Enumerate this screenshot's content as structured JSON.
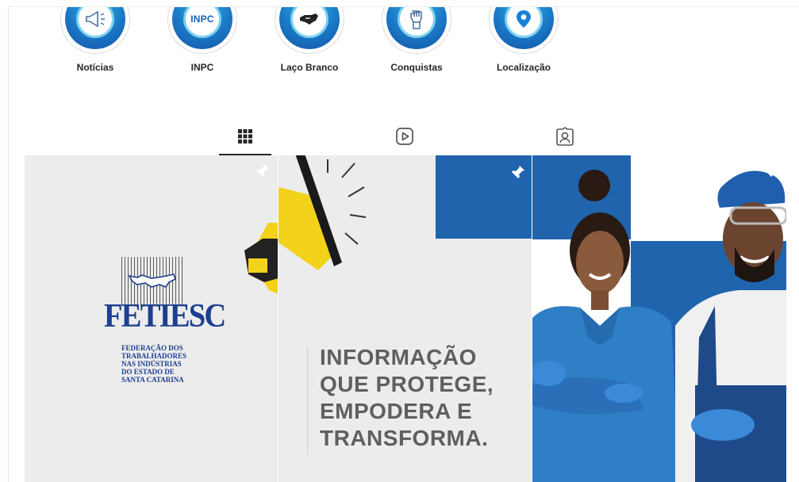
{
  "highlights": [
    {
      "label": "Notícias",
      "icon": "megaphone-icon"
    },
    {
      "label": "INPC",
      "icon": "inpc-badge",
      "badge_text": "INPC"
    },
    {
      "label": "Laço Branco",
      "icon": "hand-icon"
    },
    {
      "label": "Conquistas",
      "icon": "raised-fist-icon"
    },
    {
      "label": "Localização",
      "icon": "location-pin-icon"
    }
  ],
  "tabs": [
    {
      "name": "posts",
      "icon": "grid-icon",
      "active": true
    },
    {
      "name": "reels",
      "icon": "reels-icon",
      "active": false
    },
    {
      "name": "tagged",
      "icon": "tagged-icon",
      "active": false
    }
  ],
  "posts": [
    {
      "pinned": true,
      "logo_title": "FETIESC",
      "logo_subtitle": "FEDERAÇÃO DOS\nTRABALHADORES\nNAS INDÚSTRIAS\nDO ESTADO DE\nSANTA CATARINA"
    },
    {
      "pinned": true,
      "headline": "INFORMAÇÃO\nQUE PROTEGE,\nEMPODERA E\nTRANSFORMA."
    },
    {
      "pinned": true,
      "image": "workers-photo"
    }
  ],
  "colors": {
    "brand_blue": "#1f64ad",
    "highlight_gradient_start": "#2fb6df",
    "highlight_gradient_end": "#1553a6",
    "megaphone_yellow": "#f2d21b",
    "tile_bg": "#ececec"
  }
}
